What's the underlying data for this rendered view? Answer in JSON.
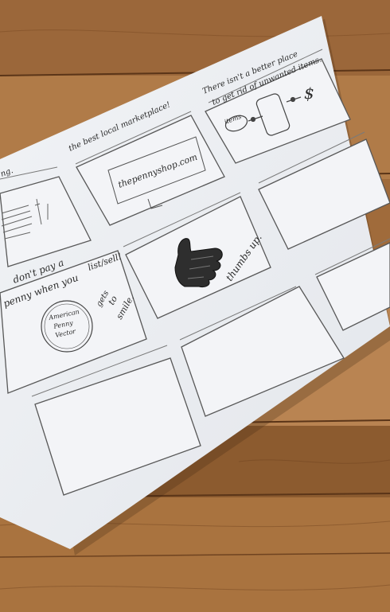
{
  "photo": {
    "wood_colors": [
      "#8a5a2e",
      "#b98452",
      "#6f4320"
    ],
    "paper_color": "#eceef2",
    "pencil_color": "#2b2b2b"
  },
  "storyboard": {
    "heading_left": "the best local marketplace!",
    "heading_right_line1": "There isn't a better place",
    "heading_right_line2": "to get rid of unwanted items.",
    "left_fragment": "ng.",
    "panel_website": "thepennyshop.com",
    "panel_flow_label": "items",
    "panel_flow_symbol": "$",
    "caption_line1": "don't pay a",
    "caption_line2": "penny when you",
    "caption_line3": "list/sell!",
    "coin_line1": "American",
    "coin_line2": "Penny",
    "coin_line3": "Vector",
    "coin_note_line1": "gets",
    "coin_note_line2": "to",
    "coin_note_line3": "smile.",
    "thumbs_label": "thumbs up."
  }
}
